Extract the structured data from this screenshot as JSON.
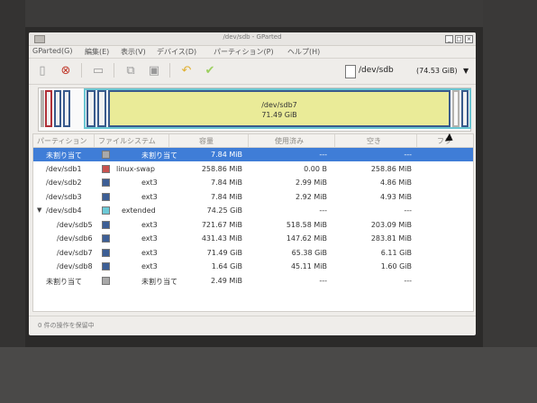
{
  "window": {
    "title": "/dev/sdb - GParted"
  },
  "menubar": {
    "items": [
      "GParted(G)",
      "編集(E)",
      "表示(V)",
      "デバイス(D)",
      "パーティション(P)",
      "ヘルプ(H)"
    ]
  },
  "toolbar": {
    "device": {
      "name": "/dev/sdb",
      "size": "(74.53 GiB)"
    }
  },
  "visual": {
    "selected_label": "/dev/sdb7",
    "selected_size": "71.49 GiB"
  },
  "table": {
    "headers": [
      "パーティション",
      "ファイルシステム",
      "容量",
      "使用済み",
      "空き",
      "フラ"
    ],
    "rows": [
      {
        "partition": "未割り当て",
        "filesystem": "未割り当て",
        "size": "7.84 MiB",
        "used": "---",
        "unused": "---",
        "swatch": "#a9a9a9",
        "indent": 0,
        "selected": true
      },
      {
        "partition": "/dev/sdb1",
        "filesystem": "linux-swap",
        "size": "258.86 MiB",
        "used": "0.00 B",
        "unused": "258.86 MiB",
        "swatch": "#c8524f",
        "indent": 0,
        "selected": false
      },
      {
        "partition": "/dev/sdb2",
        "filesystem": "ext3",
        "size": "7.84 MiB",
        "used": "2.99 MiB",
        "unused": "4.86 MiB",
        "swatch": "#3d5f96",
        "indent": 0,
        "selected": false
      },
      {
        "partition": "/dev/sdb3",
        "filesystem": "ext3",
        "size": "7.84 MiB",
        "used": "2.92 MiB",
        "unused": "4.93 MiB",
        "swatch": "#3d5f96",
        "indent": 0,
        "selected": false
      },
      {
        "partition": "/dev/sdb4",
        "filesystem": "extended",
        "size": "74.25 GiB",
        "used": "---",
        "unused": "---",
        "swatch": "#6cc9d6",
        "indent": 0,
        "selected": false,
        "expanded": true
      },
      {
        "partition": "/dev/sdb5",
        "filesystem": "ext3",
        "size": "721.67 MiB",
        "used": "518.58 MiB",
        "unused": "203.09 MiB",
        "swatch": "#3d5f96",
        "indent": 1,
        "selected": false
      },
      {
        "partition": "/dev/sdb6",
        "filesystem": "ext3",
        "size": "431.43 MiB",
        "used": "147.62 MiB",
        "unused": "283.81 MiB",
        "swatch": "#3d5f96",
        "indent": 1,
        "selected": false
      },
      {
        "partition": "/dev/sdb7",
        "filesystem": "ext3",
        "size": "71.49 GiB",
        "used": "65.38 GiB",
        "unused": "6.11 GiB",
        "swatch": "#3d5f96",
        "indent": 1,
        "selected": false
      },
      {
        "partition": "/dev/sdb8",
        "filesystem": "ext3",
        "size": "1.64 GiB",
        "used": "45.11 MiB",
        "unused": "1.60 GiB",
        "swatch": "#3d5f96",
        "indent": 1,
        "selected": false
      },
      {
        "partition": "未割り当て",
        "filesystem": "未割り当て",
        "size": "2.49 MiB",
        "used": "---",
        "unused": "---",
        "swatch": "#a9a9a9",
        "indent": 0,
        "selected": false
      }
    ]
  },
  "status": {
    "text": "0 件の操作を保留中"
  },
  "colors": {
    "selection": "#3f7dd7",
    "ext3": "#3d5f96",
    "linux_swap": "#c8524f",
    "extended": "#6cc9d6",
    "unallocated": "#a9a9a9",
    "used_fill": "#eaeb98"
  },
  "icons": [
    "new-partition-icon",
    "delete-icon",
    "resize-move-icon",
    "copy-icon",
    "paste-icon",
    "undo-icon",
    "apply-icon",
    "disk-icon",
    "dropdown-arrow-icon"
  ]
}
